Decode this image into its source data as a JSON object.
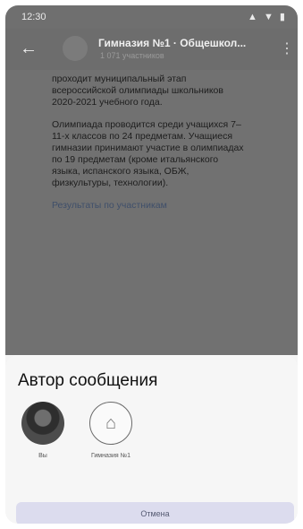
{
  "status_bar": {
    "time": "12:30",
    "icons": "▲ ▼ ▮"
  },
  "chat": {
    "title": "Гимназия №1 · Общешкол...",
    "subtitle": "1 071 участников"
  },
  "message": {
    "paragraphs": [
      "проходит муниципальный этап всероссийской олимпиады школьников 2020-2021 учебного года.",
      "Олимпиада проводится среди учащихся 7–11-х классов по 24 предметам. Учащиеся гимназии принимают участие в олимпиадах по 19 предметам (кроме итальянского языка, испанского языка, ОБЖ, физкультуры, технологии)."
    ],
    "link": "Результаты по участникам"
  },
  "sheet": {
    "title": "Автор сообщения",
    "options": [
      {
        "label": "Вы"
      },
      {
        "label": "Гимназия №1"
      }
    ],
    "cancel": "Отмена"
  }
}
